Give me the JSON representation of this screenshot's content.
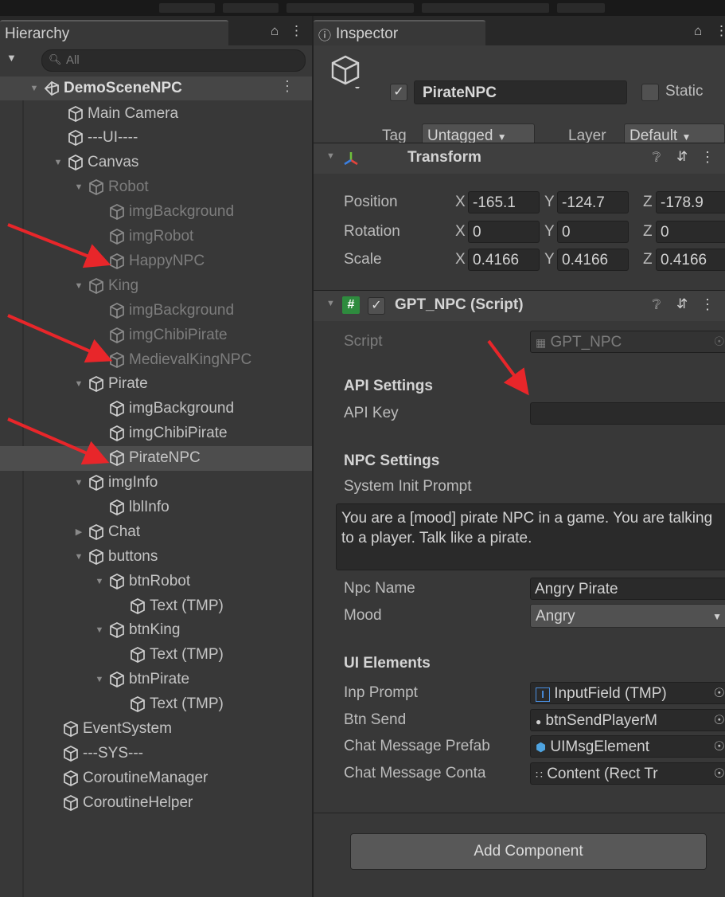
{
  "hierarchy": {
    "tab_label": "Hierarchy",
    "lock_icon": "lock-icon",
    "menu_icon": "kebab-menu-icon",
    "search_placeholder": "All",
    "scene": "DemoSceneNPC",
    "items": [
      {
        "label": "Main Camera",
        "depth": 1,
        "arrow": "",
        "dim": false
      },
      {
        "label": "---UI----",
        "depth": 1,
        "arrow": "",
        "dim": false
      },
      {
        "label": "Canvas",
        "depth": 1,
        "arrow": "down",
        "dim": false
      },
      {
        "label": "Robot",
        "depth": 2,
        "arrow": "down",
        "dim": true
      },
      {
        "label": "imgBackground",
        "depth": 3,
        "arrow": "",
        "dim": true
      },
      {
        "label": "imgRobot",
        "depth": 3,
        "arrow": "",
        "dim": true
      },
      {
        "label": "HappyNPC",
        "depth": 3,
        "arrow": "",
        "dim": true
      },
      {
        "label": "King",
        "depth": 2,
        "arrow": "down",
        "dim": true
      },
      {
        "label": "imgBackground",
        "depth": 3,
        "arrow": "",
        "dim": true
      },
      {
        "label": "imgChibiPirate",
        "depth": 3,
        "arrow": "",
        "dim": true
      },
      {
        "label": "MedievalKingNPC",
        "depth": 3,
        "arrow": "",
        "dim": true
      },
      {
        "label": "Pirate",
        "depth": 2,
        "arrow": "down",
        "dim": false
      },
      {
        "label": "imgBackground",
        "depth": 3,
        "arrow": "",
        "dim": false
      },
      {
        "label": "imgChibiPirate",
        "depth": 3,
        "arrow": "",
        "dim": false
      },
      {
        "label": "PirateNPC",
        "depth": 3,
        "arrow": "",
        "dim": false,
        "selected": true
      },
      {
        "label": "imgInfo",
        "depth": 2,
        "arrow": "down",
        "dim": false
      },
      {
        "label": "lblInfo",
        "depth": 3,
        "arrow": "",
        "dim": false
      },
      {
        "label": "Chat",
        "depth": 2,
        "arrow": "right",
        "dim": false
      },
      {
        "label": "buttons",
        "depth": 2,
        "arrow": "down",
        "dim": false
      },
      {
        "label": "btnRobot",
        "depth": 3,
        "arrow": "down",
        "dim": false
      },
      {
        "label": "Text (TMP)",
        "depth": 4,
        "arrow": "",
        "dim": false
      },
      {
        "label": "btnKing",
        "depth": 3,
        "arrow": "down",
        "dim": false
      },
      {
        "label": "Text (TMP)",
        "depth": 4,
        "arrow": "",
        "dim": false
      },
      {
        "label": "btnPirate",
        "depth": 3,
        "arrow": "down",
        "dim": false
      },
      {
        "label": "Text (TMP)",
        "depth": 4,
        "arrow": "",
        "dim": false
      },
      {
        "label": "EventSystem",
        "depth": 0,
        "arrow": "",
        "dim": false
      },
      {
        "label": "---SYS---",
        "depth": 0,
        "arrow": "",
        "dim": false
      },
      {
        "label": "CoroutineManager",
        "depth": 0,
        "arrow": "",
        "dim": false
      },
      {
        "label": "CoroutineHelper",
        "depth": 0,
        "arrow": "",
        "dim": false
      }
    ]
  },
  "inspector": {
    "tab_label": "Inspector",
    "object_name": "PirateNPC",
    "static_label": "Static",
    "tag_label": "Tag",
    "tag_value": "Untagged",
    "layer_label": "Layer",
    "layer_value": "Default",
    "transform": {
      "title": "Transform",
      "rows": [
        {
          "label": "Position",
          "x": "-165.1",
          "y": "-124.7",
          "z": "-178.9"
        },
        {
          "label": "Rotation",
          "x": "0",
          "y": "0",
          "z": "0"
        },
        {
          "label": "Scale",
          "x": "0.4166",
          "y": "0.4166",
          "z": "0.4166"
        }
      ],
      "axis_x": "X",
      "axis_y": "Y",
      "axis_z": "Z"
    },
    "script_component": {
      "title": "GPT_NPC (Script)",
      "script_label": "Script",
      "script_value": "GPT_NPC",
      "api_section": "API Settings",
      "api_key_label": "API Key",
      "api_key_value": "",
      "npc_section": "NPC Settings",
      "prompt_label": "System Init Prompt",
      "prompt_value": "You are a [mood] pirate NPC in a game. You are talking to a player. Talk like a pirate.",
      "npc_name_label": "Npc Name",
      "npc_name_value": "Angry Pirate",
      "mood_label": "Mood",
      "mood_value": "Angry",
      "ui_section": "UI Elements",
      "ui_fields": [
        {
          "label": "Inp Prompt",
          "value": "InputField (TMP)",
          "icon": "text-input-icon"
        },
        {
          "label": "Btn Send",
          "value": "btnSendPlayerM",
          "icon": "button-icon"
        },
        {
          "label": "Chat Message Prefab",
          "value": "UIMsgElement",
          "icon": "prefab-icon"
        },
        {
          "label": "Chat Message Conta",
          "value": "Content (Rect Tr",
          "icon": "rect-transform-icon"
        }
      ]
    },
    "add_component": "Add Component"
  },
  "colors": {
    "panel": "#383838",
    "dark_field": "#2a2a2a",
    "selection": "#4d4d4d",
    "annotation_arrow": "#e8262a"
  }
}
